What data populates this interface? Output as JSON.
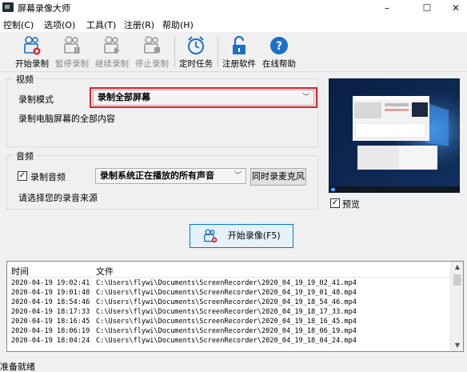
{
  "window": {
    "title": "屏幕录像大师",
    "min_icon": "minimize-icon",
    "max_icon": "maximize-icon",
    "close_icon": "close-icon",
    "min_symbol": "–",
    "max_symbol": "☐",
    "close_symbol": "✕"
  },
  "menu": [
    "控制(C)",
    "选项(O)",
    "工具(T)",
    "注册(R)",
    "帮助(H)"
  ],
  "toolbar": {
    "start": "开始录制",
    "pause": "暂停录制",
    "resume": "继续录制",
    "stop": "停止录制",
    "timer": "定时任务",
    "register": "注册软件",
    "help": "在线帮助"
  },
  "video": {
    "group_label": "视频",
    "mode_label": "录制模式",
    "mode_value": "录制全部屏幕",
    "mode_desc": "录制电脑屏幕的全部内容"
  },
  "audio": {
    "group_label": "音频",
    "record_audio_label": "录制音频",
    "record_audio_checked": true,
    "source_value": "录制系统正在播放的所有声音",
    "mic_button": "同时录麦克风",
    "hint": "请选择您的录音来源"
  },
  "preview": {
    "label": "预览",
    "checked": true
  },
  "record_button": "开始录像(F5)",
  "log": {
    "col_time": "时间",
    "col_file": "文件",
    "rows": [
      {
        "time": "2020-04-19 19:02:41",
        "file": "C:\\Users\\flywi\\Documents\\ScreenRecorder\\2020_04_19_19_02_41.mp4"
      },
      {
        "time": "2020-04-19 19:01:48",
        "file": "C:\\Users\\flywi\\Documents\\ScreenRecorder\\2020_04_19_19_01_48.mp4"
      },
      {
        "time": "2020-04-19 18:54:46",
        "file": "C:\\Users\\flywi\\Documents\\ScreenRecorder\\2020_04_19_18_54_46.mp4"
      },
      {
        "time": "2020-04-19 18:17:33",
        "file": "C:\\Users\\flywi\\Documents\\ScreenRecorder\\2020_04_19_18_17_33.mp4"
      },
      {
        "time": "2020-04-19 18:16:45",
        "file": "C:\\Users\\flywi\\Documents\\ScreenRecorder\\2020_04_19_18_16_45.mp4"
      },
      {
        "time": "2020-04-19 18:06:19",
        "file": "C:\\Users\\flywi\\Documents\\ScreenRecorder\\2020_04_19_18_06_19.mp4"
      },
      {
        "time": "2020-04-19 18:04:24",
        "file": "C:\\Users\\flywi\\Documents\\ScreenRecorder\\2020_04_19_18_04_24.mp4"
      }
    ]
  },
  "status": "准备就绪",
  "colors": {
    "accent_blue": "#0078d7",
    "record_red": "#e0202a",
    "icon_blue": "#1a6fc9"
  }
}
